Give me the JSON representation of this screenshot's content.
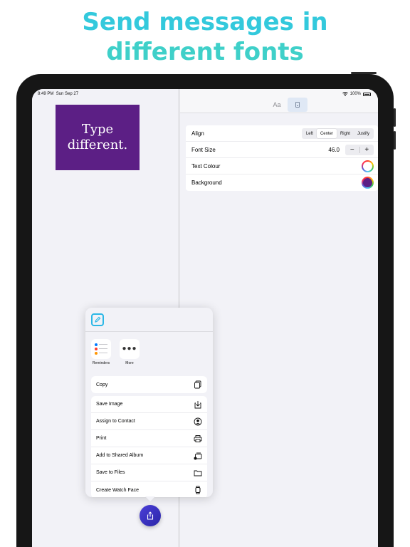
{
  "headline": {
    "line1": "Send messages in",
    "line2": "different fonts"
  },
  "status_bar": {
    "time": "8:49 PM",
    "date": "Sun Sep 27",
    "battery": "100%",
    "icons": [
      "wifi-icon",
      "battery-icon"
    ]
  },
  "preview": {
    "line1": "Type",
    "line2": "different.",
    "background": "#5c1f85",
    "text_color": "#ffffff"
  },
  "toolbar": {
    "tab_font_label": "Aa",
    "tab_doc_icon": "document-icon",
    "selected_tab": "document"
  },
  "settings": {
    "align": {
      "label": "Align",
      "options": [
        "Left",
        "Center",
        "Right",
        "Justify"
      ],
      "selected": "Center"
    },
    "font_size": {
      "label": "Font Size",
      "value": "46.0",
      "minus": "−",
      "plus": "+"
    },
    "text_colour": {
      "label": "Text Colour",
      "value": "#ffffff"
    },
    "background": {
      "label": "Background",
      "value": "#5c1f85"
    }
  },
  "share_sheet": {
    "apps": [
      {
        "label": "Reminders",
        "icon": "reminders-icon"
      },
      {
        "label": "More",
        "icon": "more-icon"
      }
    ],
    "group1": [
      {
        "label": "Copy",
        "icon": "copy-icon"
      }
    ],
    "group2": [
      {
        "label": "Save Image",
        "icon": "save-image-icon"
      },
      {
        "label": "Assign to Contact",
        "icon": "contact-icon"
      },
      {
        "label": "Print",
        "icon": "printer-icon"
      },
      {
        "label": "Add to Shared Album",
        "icon": "shared-album-icon"
      },
      {
        "label": "Save to Files",
        "icon": "folder-icon"
      },
      {
        "label": "Create Watch Face",
        "icon": "watch-icon"
      }
    ]
  },
  "colors": {
    "headline_cyan": "#33c9dc",
    "accent": "#2bb7e6",
    "share_button": "#3b32c8"
  }
}
